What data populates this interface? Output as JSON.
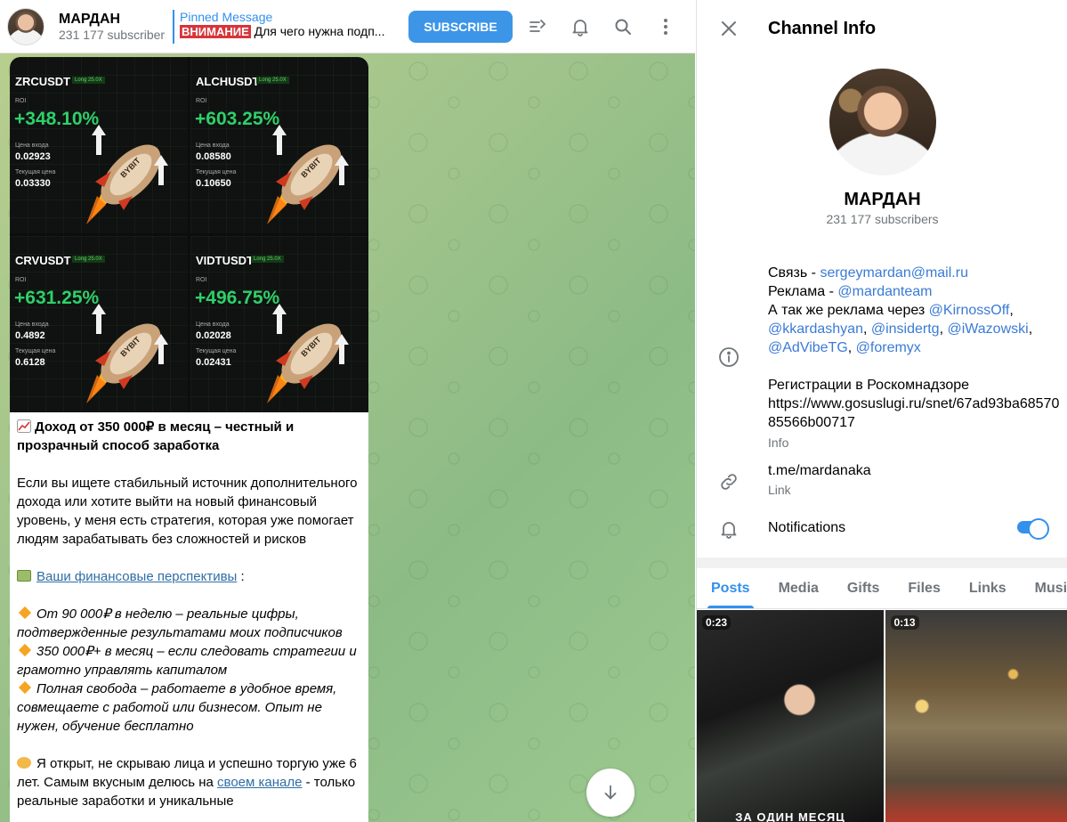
{
  "header": {
    "channel_name": "МАРДАН",
    "subscribers": "231 177 subscribers",
    "pinned_title": "Pinned Message",
    "pinned_tag": "ВНИМАНИЕ",
    "pinned_text": "Для чего нужна подп...",
    "subscribe_label": "SUBSCRIBE",
    "icons": [
      "manage-discussion-icon",
      "bell-icon",
      "search-icon",
      "more-vertical-icon"
    ]
  },
  "message": {
    "tiles": [
      {
        "pair": "ZRCUSDT",
        "badge": "Long 25.0X",
        "roi_label": "ROI",
        "roi": "+348.10%",
        "entry_label": "Цена входа",
        "entry": "0.02923",
        "current_label": "Текущая цена",
        "current": "0.03330"
      },
      {
        "pair": "ALCHUSDT",
        "badge": "Long 25.0X",
        "roi_label": "ROI",
        "roi": "+603.25%",
        "entry_label": "Цена входа",
        "entry": "0.08580",
        "current_label": "Текущая цена",
        "current": "0.10650"
      },
      {
        "pair": "CRVUSDT",
        "badge": "Long 25.0X",
        "roi_label": "ROI",
        "roi": "+631.25%",
        "entry_label": "Цена входа",
        "entry": "0.4892",
        "current_label": "Текущая цена",
        "current": "0.6128"
      },
      {
        "pair": "VIDTUSDT",
        "badge": "Long 25.0X",
        "roi_label": "ROI",
        "roi": "+496.75%",
        "entry_label": "Цена входа",
        "entry": "0.02028",
        "current_label": "Текущая цена",
        "current": "0.02431"
      }
    ],
    "rocket_label": "BYBIT",
    "headline": "Доход от 350 000₽ в месяц – честный и прозрачный способ заработка",
    "intro": "Если вы ищете стабильный источник дополнительного дохода или хотите выйти на новый финансовый уровень, у меня есть стратегия, которая уже помогает людям зарабатывать без сложностей и рисков",
    "perspectives_link": "Ваши финансовые перспективы",
    "perspectives_colon": " :",
    "bullets": [
      "От 90 000₽ в неделю – реальные цифры, подтвержденные результатами моих подписчиков",
      "350 000₽+ в месяц – если следовать стратегии и грамотно управлять капиталом",
      "Полная свобода – работаете в удобное время, совмещаете с работой или бизнесом. Опыт не нужен, обучение бесплатно"
    ],
    "outro_before": "Я открыт, не скрываю лица и успешно торгую уже 6 лет. Самым вкусным делюсь на ",
    "outro_link": "своем канале",
    "outro_after": " - только реальные заработки и уникальные"
  },
  "info": {
    "title": "Channel Info",
    "name": "МАРДАН",
    "subscribers": "231 177 subscribers",
    "contact_label": "Связь - ",
    "contact_email": "sergeymardan@mail.ru",
    "ads_label": "Реклама - ",
    "ads_handle": "@mardanteam",
    "also_label": "А так же реклама через ",
    "also_handles": [
      "@KirnossOff",
      "@kkardashyan",
      "@insidertg",
      "@iWazowski",
      "@AdVibeTG",
      "@foremyx"
    ],
    "registry_title": "Регистрации в Роскомнадзоре",
    "registry_url": "https://www.gosuslugi.ru/snet/67ad93ba6857085566b00717",
    "info_caption": "Info",
    "link": "t.me/mardanaka",
    "link_caption": "Link",
    "notifications_label": "Notifications",
    "notifications_on": true,
    "tabs": [
      "Posts",
      "Media",
      "Gifts",
      "Files",
      "Links",
      "Music"
    ],
    "active_tab": "Posts",
    "media": [
      {
        "duration": "0:23",
        "caption": "ЗА ОДИН МЕСЯЦ"
      },
      {
        "duration": "0:13"
      }
    ]
  },
  "colors": {
    "accent": "#3390ec",
    "subscribe": "#3d95e8",
    "tag_red": "#d6353b",
    "roi_green": "#2fd06a"
  }
}
